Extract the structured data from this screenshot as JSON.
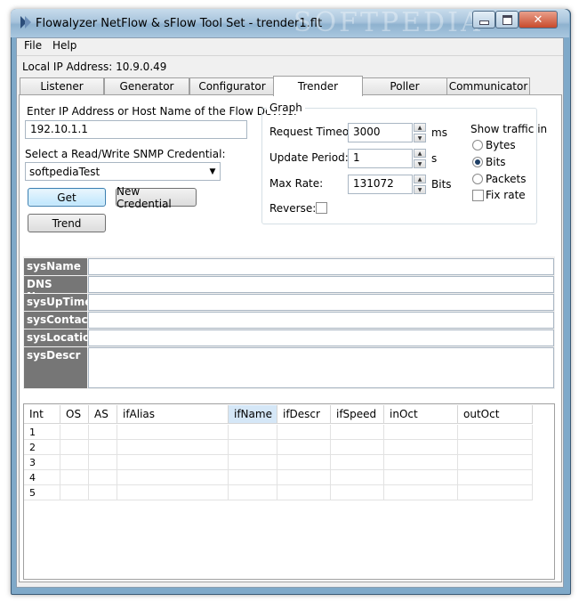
{
  "window": {
    "title": "Flowalyzer NetFlow & sFlow Tool Set - trender1.flt",
    "watermark": "SOFTPEDIA"
  },
  "menu": {
    "items": [
      "File",
      "Help"
    ]
  },
  "local_ip_label": "Local IP Address: 10.9.0.49",
  "tabs": [
    {
      "label": "Listener",
      "active": false
    },
    {
      "label": "Generator",
      "active": false
    },
    {
      "label": "Configurator",
      "active": false
    },
    {
      "label": "Trender",
      "active": true
    },
    {
      "label": "Poller",
      "active": false
    },
    {
      "label": "Communicator",
      "active": false
    }
  ],
  "device": {
    "label": "Enter IP Address or Host Name of the Flow Device:",
    "value": "192.10.1.1"
  },
  "snmp": {
    "label": "Select a Read/Write SNMP Credential:",
    "selected": "softpediaTest"
  },
  "buttons": {
    "get": "Get",
    "new_credential": "New Credential",
    "trend": "Trend"
  },
  "graph": {
    "title": "Graph",
    "request_timeout": {
      "label": "Request Timeout:",
      "value": "3000",
      "unit": "ms"
    },
    "update_period": {
      "label": "Update Period:",
      "value": "1",
      "unit": "s"
    },
    "max_rate": {
      "label": "Max Rate:",
      "value": "131072",
      "unit": "Bits"
    },
    "reverse": {
      "label": "Reverse:",
      "checked": false
    },
    "show_traffic": {
      "label": "Show traffic in",
      "options": [
        "Bytes",
        "Bits",
        "Packets"
      ],
      "selected": "Bits",
      "fix_rate_label": "Fix rate",
      "fix_rate_checked": false
    }
  },
  "sysinfo": [
    {
      "label": "sysName",
      "value": ""
    },
    {
      "label": "DNS Name",
      "value": ""
    },
    {
      "label": "sysUpTime",
      "value": ""
    },
    {
      "label": "sysContact",
      "value": ""
    },
    {
      "label": "sysLocation",
      "value": ""
    },
    {
      "label": "sysDescr",
      "value": ""
    }
  ],
  "interfaces": {
    "columns": [
      "Int",
      "OS",
      "AS",
      "ifAlias",
      "ifName",
      "ifDescr",
      "ifSpeed",
      "inOct",
      "outOct"
    ],
    "selected_column": "ifName",
    "rows": [
      {
        "int": "1"
      },
      {
        "int": "2"
      },
      {
        "int": "3"
      },
      {
        "int": "4"
      },
      {
        "int": "5"
      }
    ]
  }
}
